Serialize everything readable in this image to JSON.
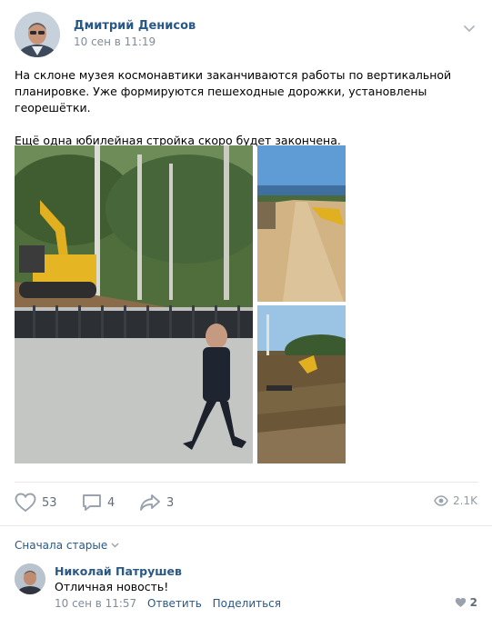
{
  "post": {
    "author": "Дмитрий Денисов",
    "date": "10 сен в 11:19",
    "text_p1": "На склоне музея космонавтики заканчиваются работы по вертикальной планировке. Уже формируются пешеходные дорожки, установлены георешётки.",
    "text_p2": "Ещё одна юбилейная стройка скоро будет закончена."
  },
  "actions": {
    "likes": "53",
    "comments": "4",
    "shares": "3",
    "views": "2.1K"
  },
  "comments_section": {
    "sort_label": "Сначала старые"
  },
  "comment": {
    "author": "Николай Патрушев",
    "text": "Отличная новость!",
    "date": "10 сен в 11:57",
    "reply_label": "Ответить",
    "share_label": "Поделиться",
    "likes": "2"
  },
  "colors": {
    "link": "#2a5885",
    "meta": "#818c99",
    "icon": "#99a2ad"
  }
}
